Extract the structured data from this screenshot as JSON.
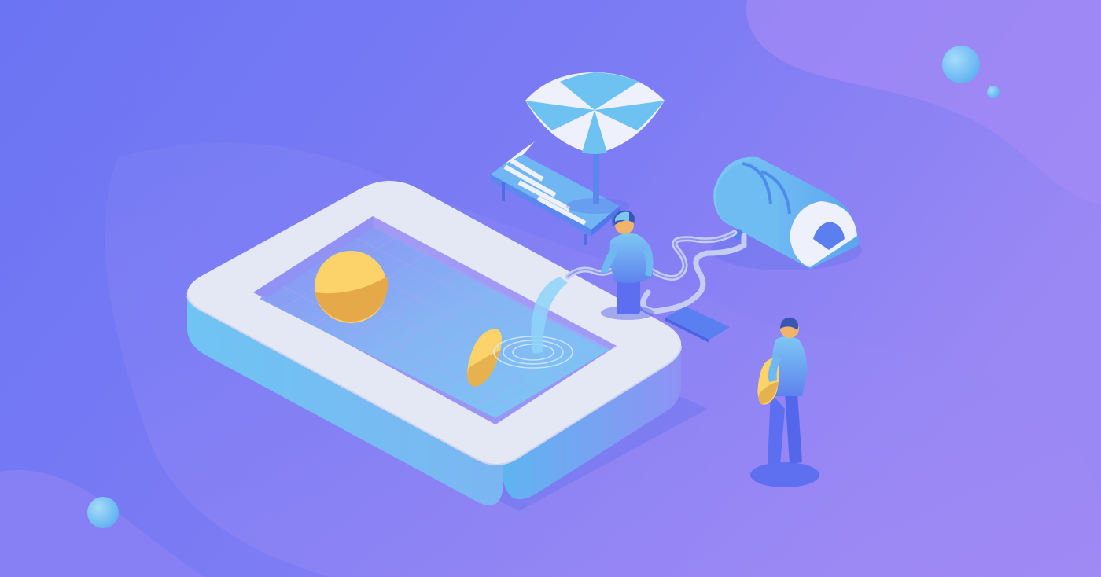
{
  "illustration": {
    "theme": "isometric pool party scene",
    "colors": {
      "background_left": "#6f78f4",
      "background_right": "#9b86f3",
      "blob_light": "#a48af5",
      "blob_dark": "#6c79f2",
      "pool_rim": "#e4e7f3",
      "pool_side": "#6fc3f2",
      "water": "#76c7f4",
      "tile_line": "#9fa6f3",
      "ball_yellow": "#fbd36a",
      "ball_shadow": "#e6b24f",
      "umbrella_white": "#eef0fb",
      "umbrella_blue": "#6ec2f2",
      "person_shirt": "#6fb9f0",
      "person_pants": "#5b6ff0",
      "skin": "#f0b46a",
      "hair": "#3a56b4",
      "bubble": "#7cc8f5"
    },
    "objects": [
      "pool",
      "beach-ball",
      "floating-board",
      "beach-umbrella",
      "lounge-chair",
      "pool-filter-tank",
      "water-hose",
      "person-with-hose",
      "person-with-float",
      "mat",
      "bubbles"
    ]
  }
}
